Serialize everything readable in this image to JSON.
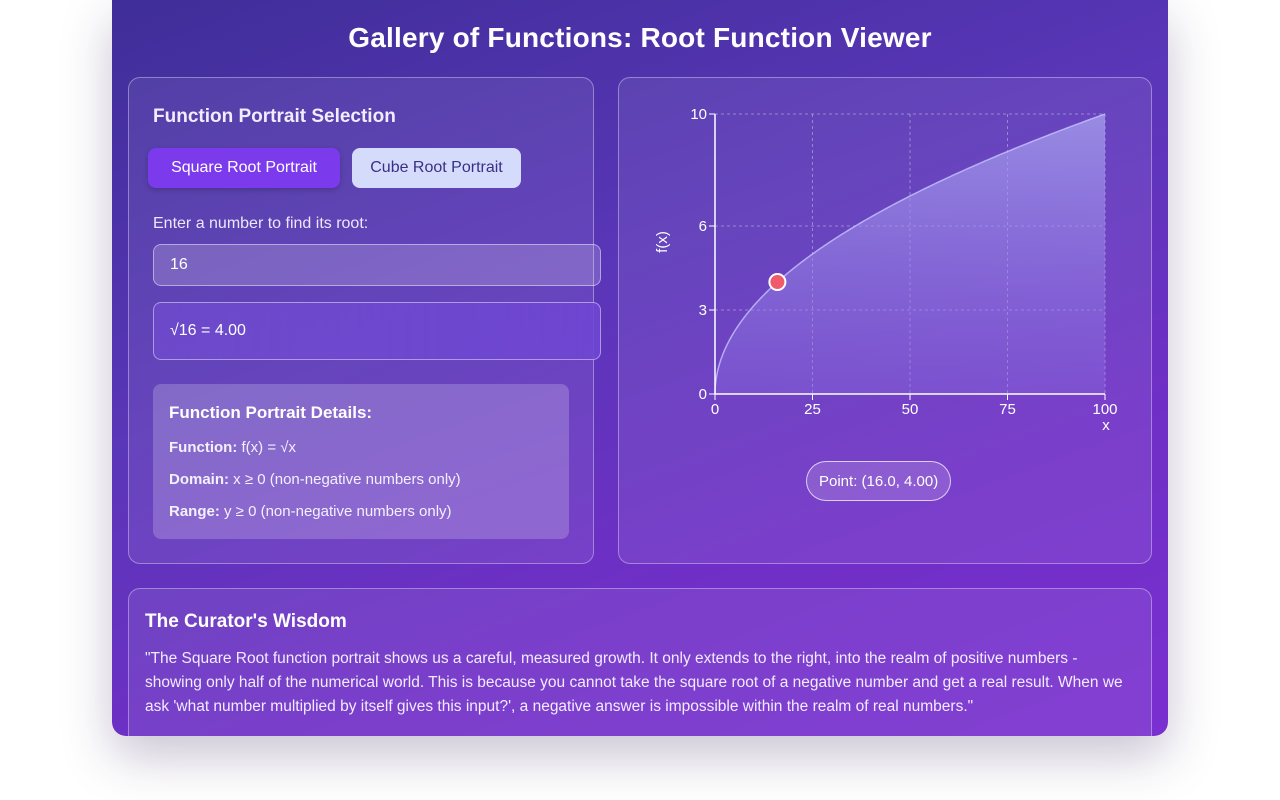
{
  "title": "Gallery of Functions: Root Function Viewer",
  "selection": {
    "heading": "Function Portrait Selection",
    "buttons": [
      {
        "label": "Square Root Portrait",
        "active": true
      },
      {
        "label": "Cube Root Portrait",
        "active": false
      }
    ],
    "prompt": "Enter a number to find its root:",
    "input_value": "16",
    "result": "√16 = 4.00"
  },
  "details": {
    "heading": "Function Portrait Details:",
    "function_label": "Function:",
    "function_value": " f(x) = √x",
    "domain_label": "Domain:",
    "domain_value": " x ≥ 0 (non-negative numbers only)",
    "range_label": "Range:",
    "range_value": " y ≥ 0 (non-negative numbers only)"
  },
  "chart_data": {
    "type": "area",
    "function": "sqrt",
    "xlabel": "x",
    "ylabel": "f(x)",
    "xlim": [
      0,
      100
    ],
    "ylim": [
      0,
      10
    ],
    "xticks": [
      0,
      25,
      50,
      75,
      100
    ],
    "yticks": [
      0,
      3,
      6,
      10
    ],
    "grid": true,
    "highlight_point": {
      "x": 16,
      "y": 4
    }
  },
  "point_label": "Point: (16.0, 4.00)",
  "wisdom": {
    "heading": "The Curator's Wisdom",
    "text": "\"The Square Root function portrait shows us a careful, measured growth. It only extends to the right, into the realm of positive numbers - showing only half of the numerical world. This is because you cannot take the square root of a negative number and get a real result. When we ask 'what number multiplied by itself gives this input?', a negative answer is impossible within the realm of real numbers.\""
  },
  "colors": {
    "accent": "#7c3aed",
    "point": "#ef5b6b"
  }
}
